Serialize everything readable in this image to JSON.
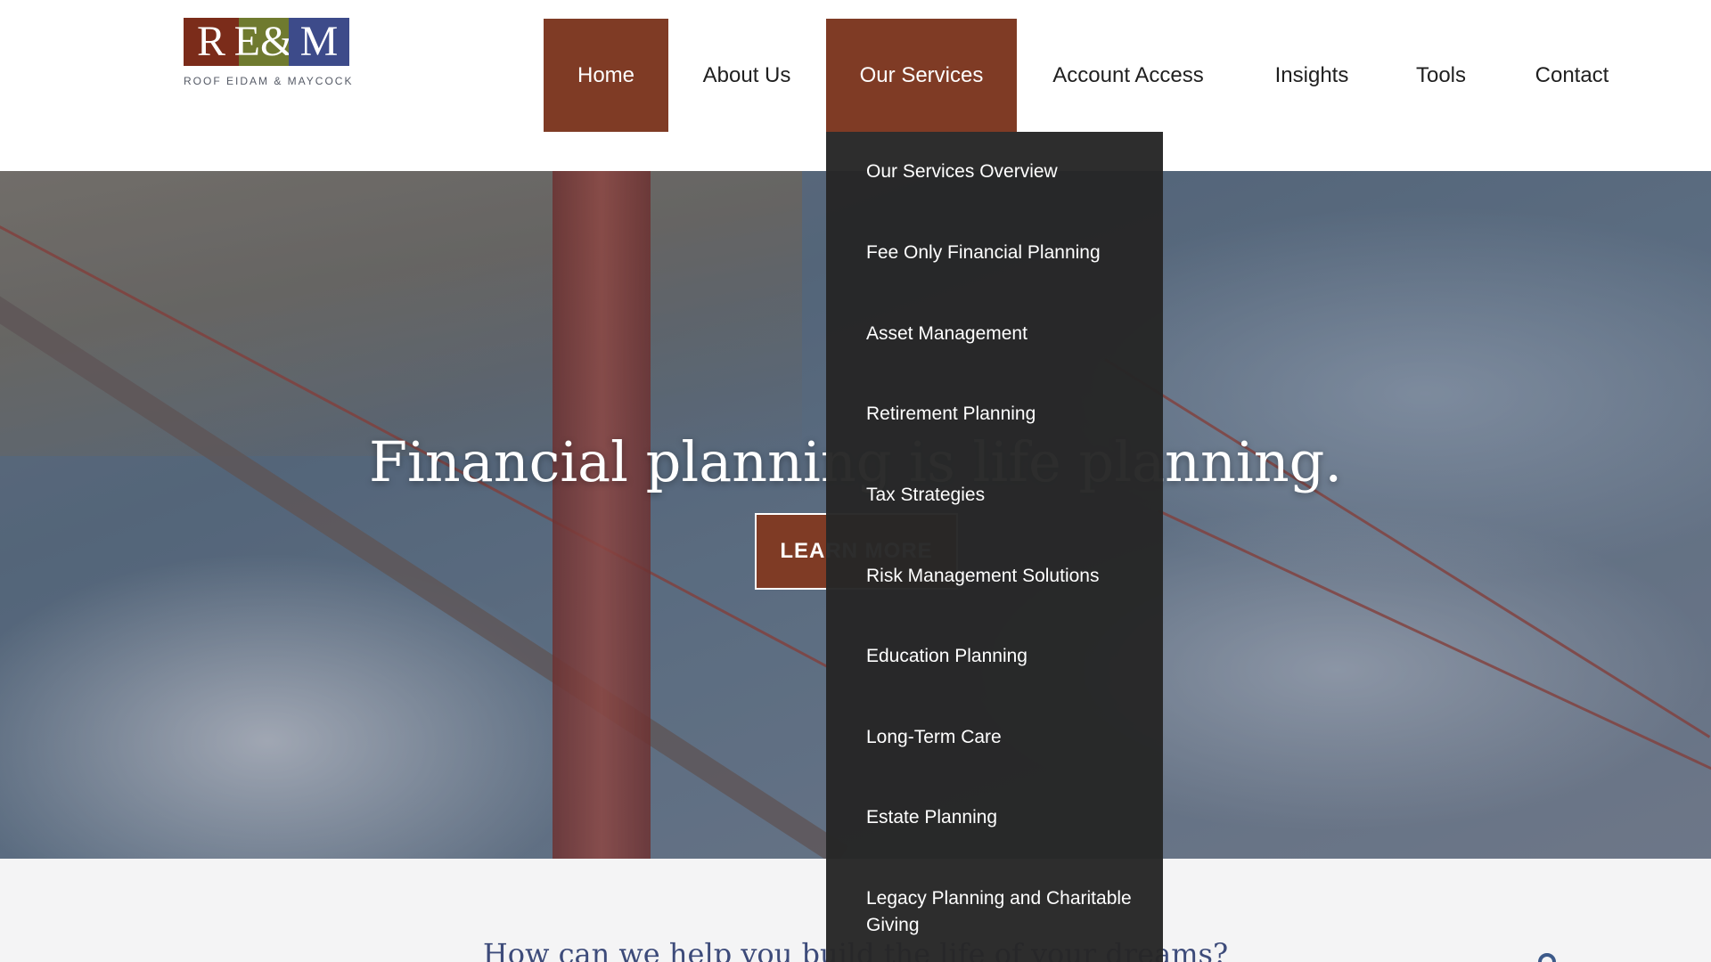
{
  "logo": {
    "letters": [
      "R",
      "E&",
      "M"
    ],
    "tagline": "ROOF EIDAM & MAYCOCK"
  },
  "nav": {
    "items": [
      {
        "label": "Home"
      },
      {
        "label": "About Us"
      },
      {
        "label": "Our Services"
      },
      {
        "label": "Account Access"
      },
      {
        "label": "Insights"
      },
      {
        "label": "Tools"
      },
      {
        "label": "Contact"
      }
    ],
    "active_items": [
      "Home",
      "Our Services"
    ]
  },
  "services_menu": {
    "items": [
      {
        "label": "Our Services Overview"
      },
      {
        "label": "Fee Only Financial Planning"
      },
      {
        "label": "Asset Management"
      },
      {
        "label": "Retirement Planning"
      },
      {
        "label": "Tax Strategies"
      },
      {
        "label": "Risk Management Solutions"
      },
      {
        "label": "Education Planning"
      },
      {
        "label": "Long-Term Care"
      },
      {
        "label": "Estate Planning"
      },
      {
        "label": "Legacy Planning and Charitable Giving"
      }
    ]
  },
  "hero": {
    "title": "Financial planning is life planning.",
    "button_label": "LEARN MORE"
  },
  "lower": {
    "title": "How can we help you build the life of your dreams?"
  },
  "colors": {
    "accent": "#7f3b25",
    "dropdown_bg": "#262626",
    "heading_blue": "#3d4b7a"
  }
}
